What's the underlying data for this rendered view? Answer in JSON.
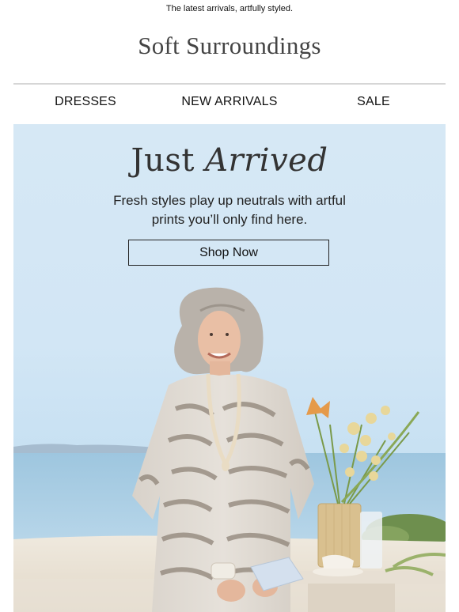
{
  "preheader": "The latest arrivals, artfully styled.",
  "brand": {
    "logo_text": "Soft Surroundings"
  },
  "nav": {
    "items": [
      {
        "label": "DRESSES"
      },
      {
        "label": "NEW ARRIVALS"
      },
      {
        "label": "SALE"
      }
    ]
  },
  "hero": {
    "headline_plain": "Just",
    "headline_italic": "Arrived",
    "subcopy": "Fresh styles play up neutrals with artful prints you’ll only find here.",
    "cta_label": "Shop Now"
  },
  "colors": {
    "hero_background": "#d3e7f5",
    "text": "#1a1a1a",
    "divider": "#d6d6d6"
  }
}
